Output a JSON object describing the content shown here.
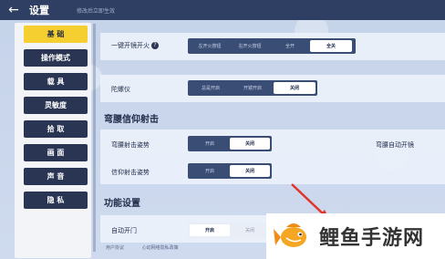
{
  "header": {
    "back_icon": "arrow-left-icon",
    "title": "设置",
    "hint": "修改后立即生效"
  },
  "sidebar": {
    "items": [
      {
        "label": "基 础",
        "active": true
      },
      {
        "label": "操作模式",
        "active": false
      },
      {
        "label": "载 具",
        "active": false
      },
      {
        "label": "灵敏度",
        "active": false
      },
      {
        "label": "拾 取",
        "active": false
      },
      {
        "label": "画 面",
        "active": false
      },
      {
        "label": "声 音",
        "active": false
      },
      {
        "label": "隐 私",
        "active": false
      }
    ]
  },
  "settings": {
    "auto_fire": {
      "label": "一键开镜开火",
      "options": [
        "左开火按钮",
        "右开火按钮",
        "全开",
        "全关"
      ],
      "selected": "全关"
    },
    "gyroscope": {
      "label": "陀螺仪",
      "options": [
        "总是开启",
        "开镜开启",
        "关闭"
      ],
      "selected": "关闭"
    },
    "hip_fire_section": "弯腰信仰射击",
    "hip_fire_posture": {
      "label": "弯腰射击姿势",
      "options": [
        "开启",
        "关闭"
      ],
      "selected": "关闭",
      "right_label": "弯腰自动开镜"
    },
    "faith_fire_posture": {
      "label": "信仰射击姿势",
      "options": [
        "开启",
        "关闭"
      ],
      "selected": "关闭"
    },
    "function_section": "功能设置",
    "auto_door": {
      "label": "自动开门",
      "options": [
        "开启",
        "关闭"
      ],
      "selected": "开启"
    }
  },
  "footer": {
    "user_agreement": "用户协议",
    "privacy": "心动网络隐私政策"
  },
  "watermark": {
    "text": "鲤鱼手游网",
    "logo_icon": "carp-fish-icon",
    "color": "#f5a623"
  },
  "colors": {
    "sidebar_active": "#f5cf2f",
    "sidebar_inactive": "#2a3553",
    "segment_bg": "#3a4d74",
    "topbar": "#2f3f63"
  }
}
